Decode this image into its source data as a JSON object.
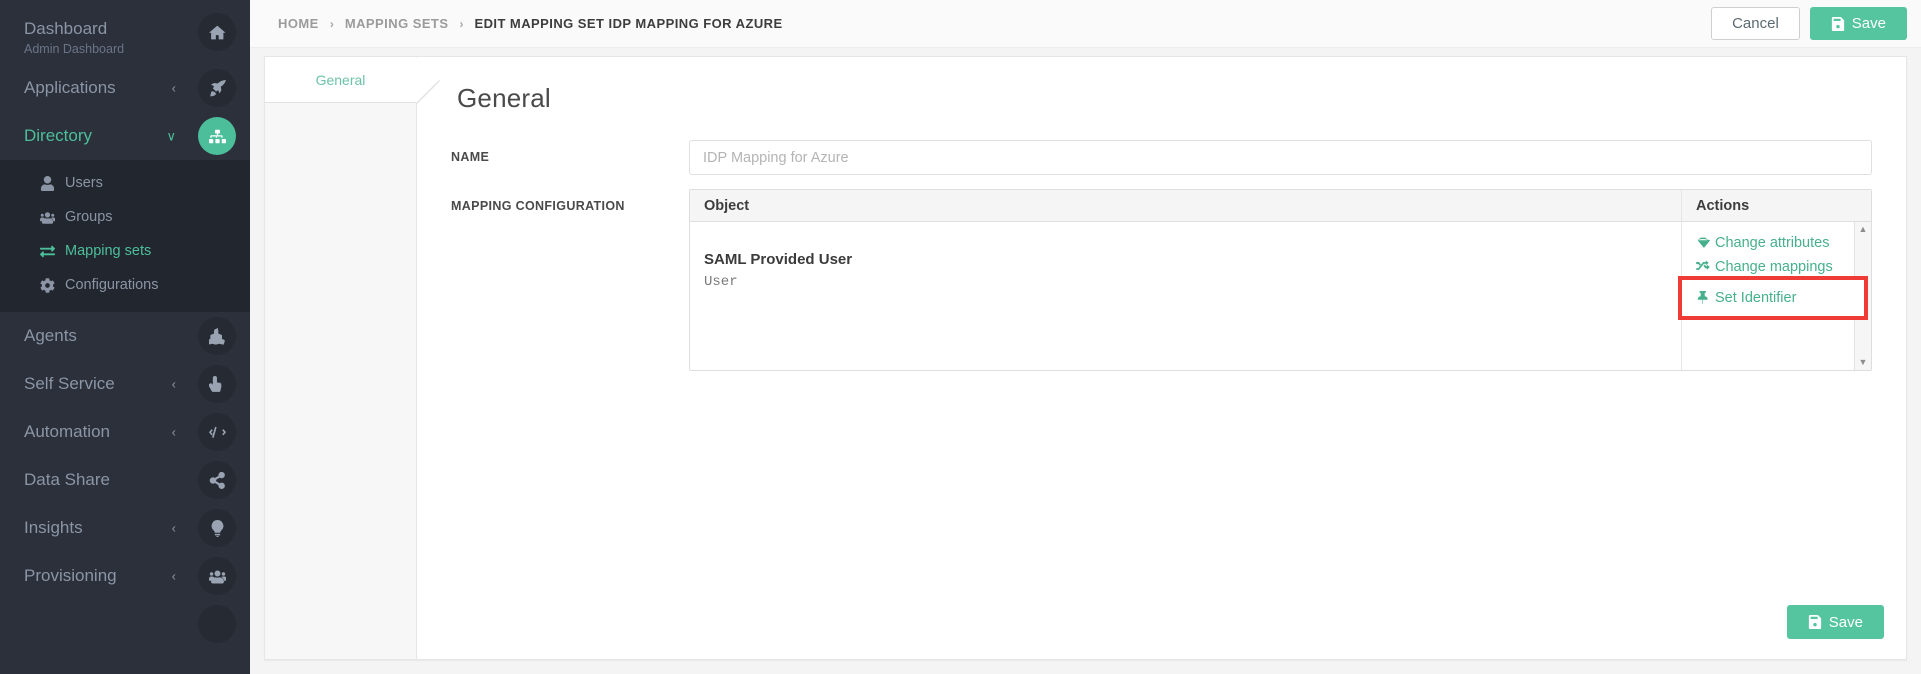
{
  "sidebar": {
    "items": [
      {
        "label": "Dashboard",
        "sublabel": "Admin Dashboard",
        "icon": "home-icon",
        "active": false,
        "caret": ""
      },
      {
        "label": "Applications",
        "icon": "rocket-icon",
        "active": false,
        "caret": "‹"
      },
      {
        "label": "Directory",
        "icon": "sitemap-icon",
        "active": true,
        "caret": "∨"
      },
      {
        "label": "Agents",
        "icon": "cubes-icon",
        "active": false,
        "caret": ""
      },
      {
        "label": "Self Service",
        "icon": "hand-pointer-icon",
        "active": false,
        "caret": "‹"
      },
      {
        "label": "Automation",
        "icon": "code-icon",
        "active": false,
        "caret": "‹"
      },
      {
        "label": "Data Share",
        "icon": "share-alt-icon",
        "active": false,
        "caret": ""
      },
      {
        "label": "Insights",
        "icon": "lightbulb-icon",
        "active": false,
        "caret": "‹"
      },
      {
        "label": "Provisioning",
        "icon": "users-cog-icon",
        "active": false,
        "caret": "‹"
      }
    ],
    "submenu": [
      {
        "label": "Users",
        "icon": "user-icon",
        "active": false
      },
      {
        "label": "Groups",
        "icon": "users-icon",
        "active": false
      },
      {
        "label": "Mapping sets",
        "icon": "exchange-icon",
        "active": true
      },
      {
        "label": "Configurations",
        "icon": "gear-icon",
        "active": false
      }
    ]
  },
  "breadcrumb": {
    "items": [
      {
        "label": "HOME",
        "current": false
      },
      {
        "label": "MAPPING SETS",
        "current": false
      },
      {
        "label": "EDIT MAPPING SET IDP MAPPING FOR AZURE",
        "current": true
      }
    ],
    "separator": "›"
  },
  "topbar": {
    "cancel_label": "Cancel",
    "save_label": "Save",
    "save_icon": "floppy-disk-icon"
  },
  "wizard": {
    "tabs": [
      {
        "label": "General",
        "active": true
      }
    ]
  },
  "form": {
    "title": "General",
    "name_label": "NAME",
    "name_value": "",
    "name_placeholder": "IDP Mapping for Azure",
    "mapping_label": "MAPPING CONFIGURATION"
  },
  "table": {
    "columns": {
      "object": "Object",
      "actions": "Actions"
    },
    "rows": [
      {
        "object_title": "SAML Provided User",
        "object_subtitle": "User",
        "actions": [
          {
            "label": "Change attributes",
            "icon": "gem-icon",
            "highlighted": false
          },
          {
            "label": "Change mappings",
            "icon": "shuffle-icon",
            "highlighted": false
          },
          {
            "label": "Set Identifier",
            "icon": "thumbtack-icon",
            "highlighted": true
          }
        ]
      }
    ],
    "scroll_up": "▲",
    "scroll_down": "▼"
  },
  "footer": {
    "save_label": "Save",
    "save_icon": "floppy-disk-icon"
  },
  "colors": {
    "accent_green": "#4cbf9a",
    "button_green": "#55c5a0",
    "link_green": "#46b08d",
    "sidebar_bg": "#2b303b",
    "submenu_bg": "#22262e",
    "highlight_red": "#ef3b35"
  }
}
